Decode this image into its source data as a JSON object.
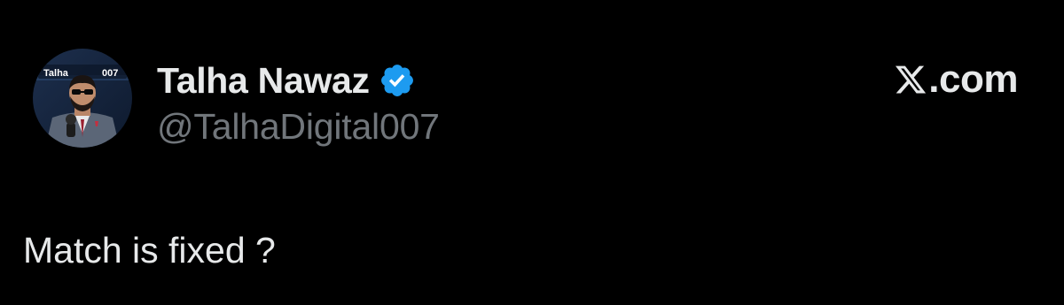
{
  "author": {
    "display_name": "Talha Nawaz",
    "handle": "@TalhaDigital007",
    "verified": true,
    "avatar_text": "Talha Digital 007"
  },
  "brand": {
    "text": ".com",
    "icon": "x-logo-icon"
  },
  "post": {
    "text": "Match is fixed ?"
  },
  "colors": {
    "background": "#000000",
    "primary_text": "#e7e9ea",
    "secondary_text": "#71767b",
    "verified_blue": "#1d9bf0"
  }
}
